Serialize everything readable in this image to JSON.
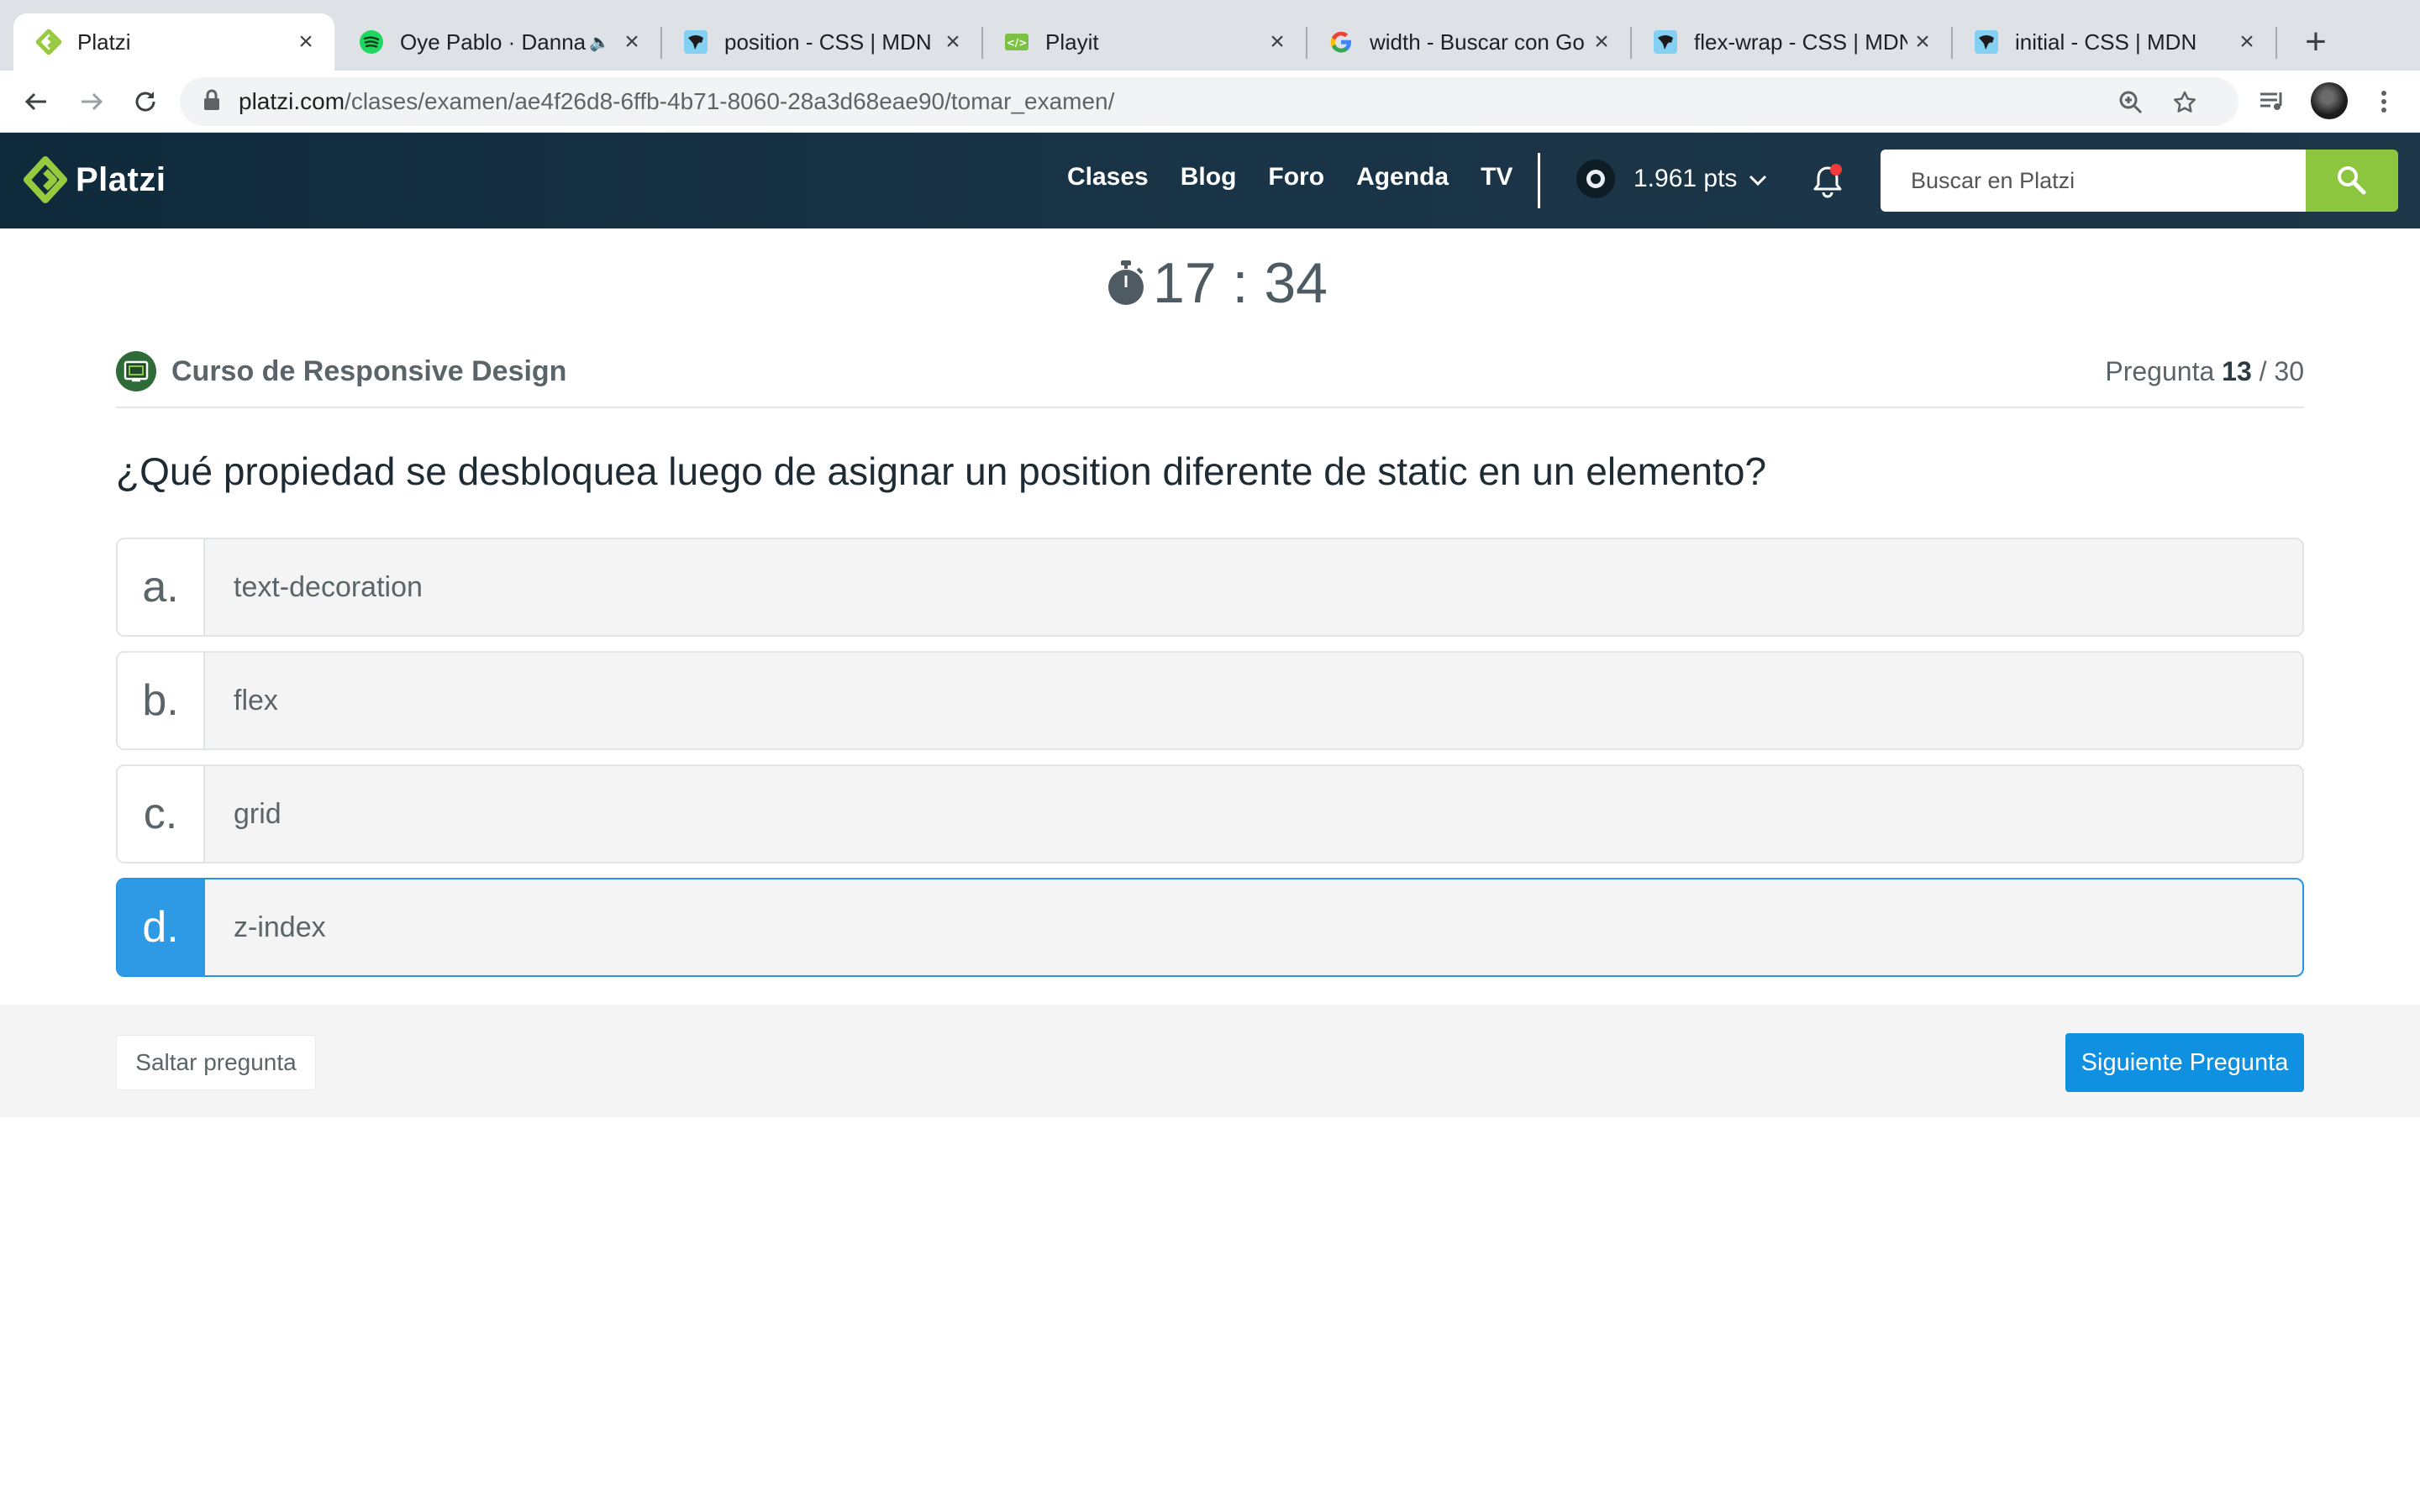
{
  "browser": {
    "tabs": [
      {
        "title": "Platzi",
        "active": true
      },
      {
        "title": "Oye Pablo · Danna",
        "playing_audio": true
      },
      {
        "title": "position - CSS | MDN"
      },
      {
        "title": "Playit"
      },
      {
        "title": "width - Buscar con Go"
      },
      {
        "title": "flex-wrap - CSS | MDN"
      },
      {
        "title": "initial - CSS | MDN"
      }
    ],
    "url_domain": "platzi.com",
    "url_path": "/clases/examen/ae4f26d8-6ffb-4b71-8060-28a3d68eae90/tomar_examen/"
  },
  "header": {
    "logo_text": "Platzi",
    "nav": [
      "Clases",
      "Blog",
      "Foro",
      "Agenda",
      "TV"
    ],
    "points": "1.961 pts",
    "search_placeholder": "Buscar en Platzi",
    "accent_color": "#8cc63f",
    "notification_dot": true
  },
  "exam": {
    "timer": "17 : 34",
    "course_name": "Curso de Responsive Design",
    "question_label": "Pregunta",
    "question_current": "13",
    "question_total": "/ 30",
    "question_text": "¿Qué propiedad se desbloquea luego de asignar un position diferente de static en un elemento?",
    "options": [
      {
        "letter": "a.",
        "text": "text-decoration",
        "selected": false
      },
      {
        "letter": "b.",
        "text": "flex",
        "selected": false
      },
      {
        "letter": "c.",
        "text": "grid",
        "selected": false
      },
      {
        "letter": "d.",
        "text": "z-index",
        "selected": true
      }
    ],
    "selected_color": "#2e9ae6"
  },
  "footer": {
    "skip_label": "Saltar pregunta",
    "next_label": "Siguiente Pregunta"
  }
}
